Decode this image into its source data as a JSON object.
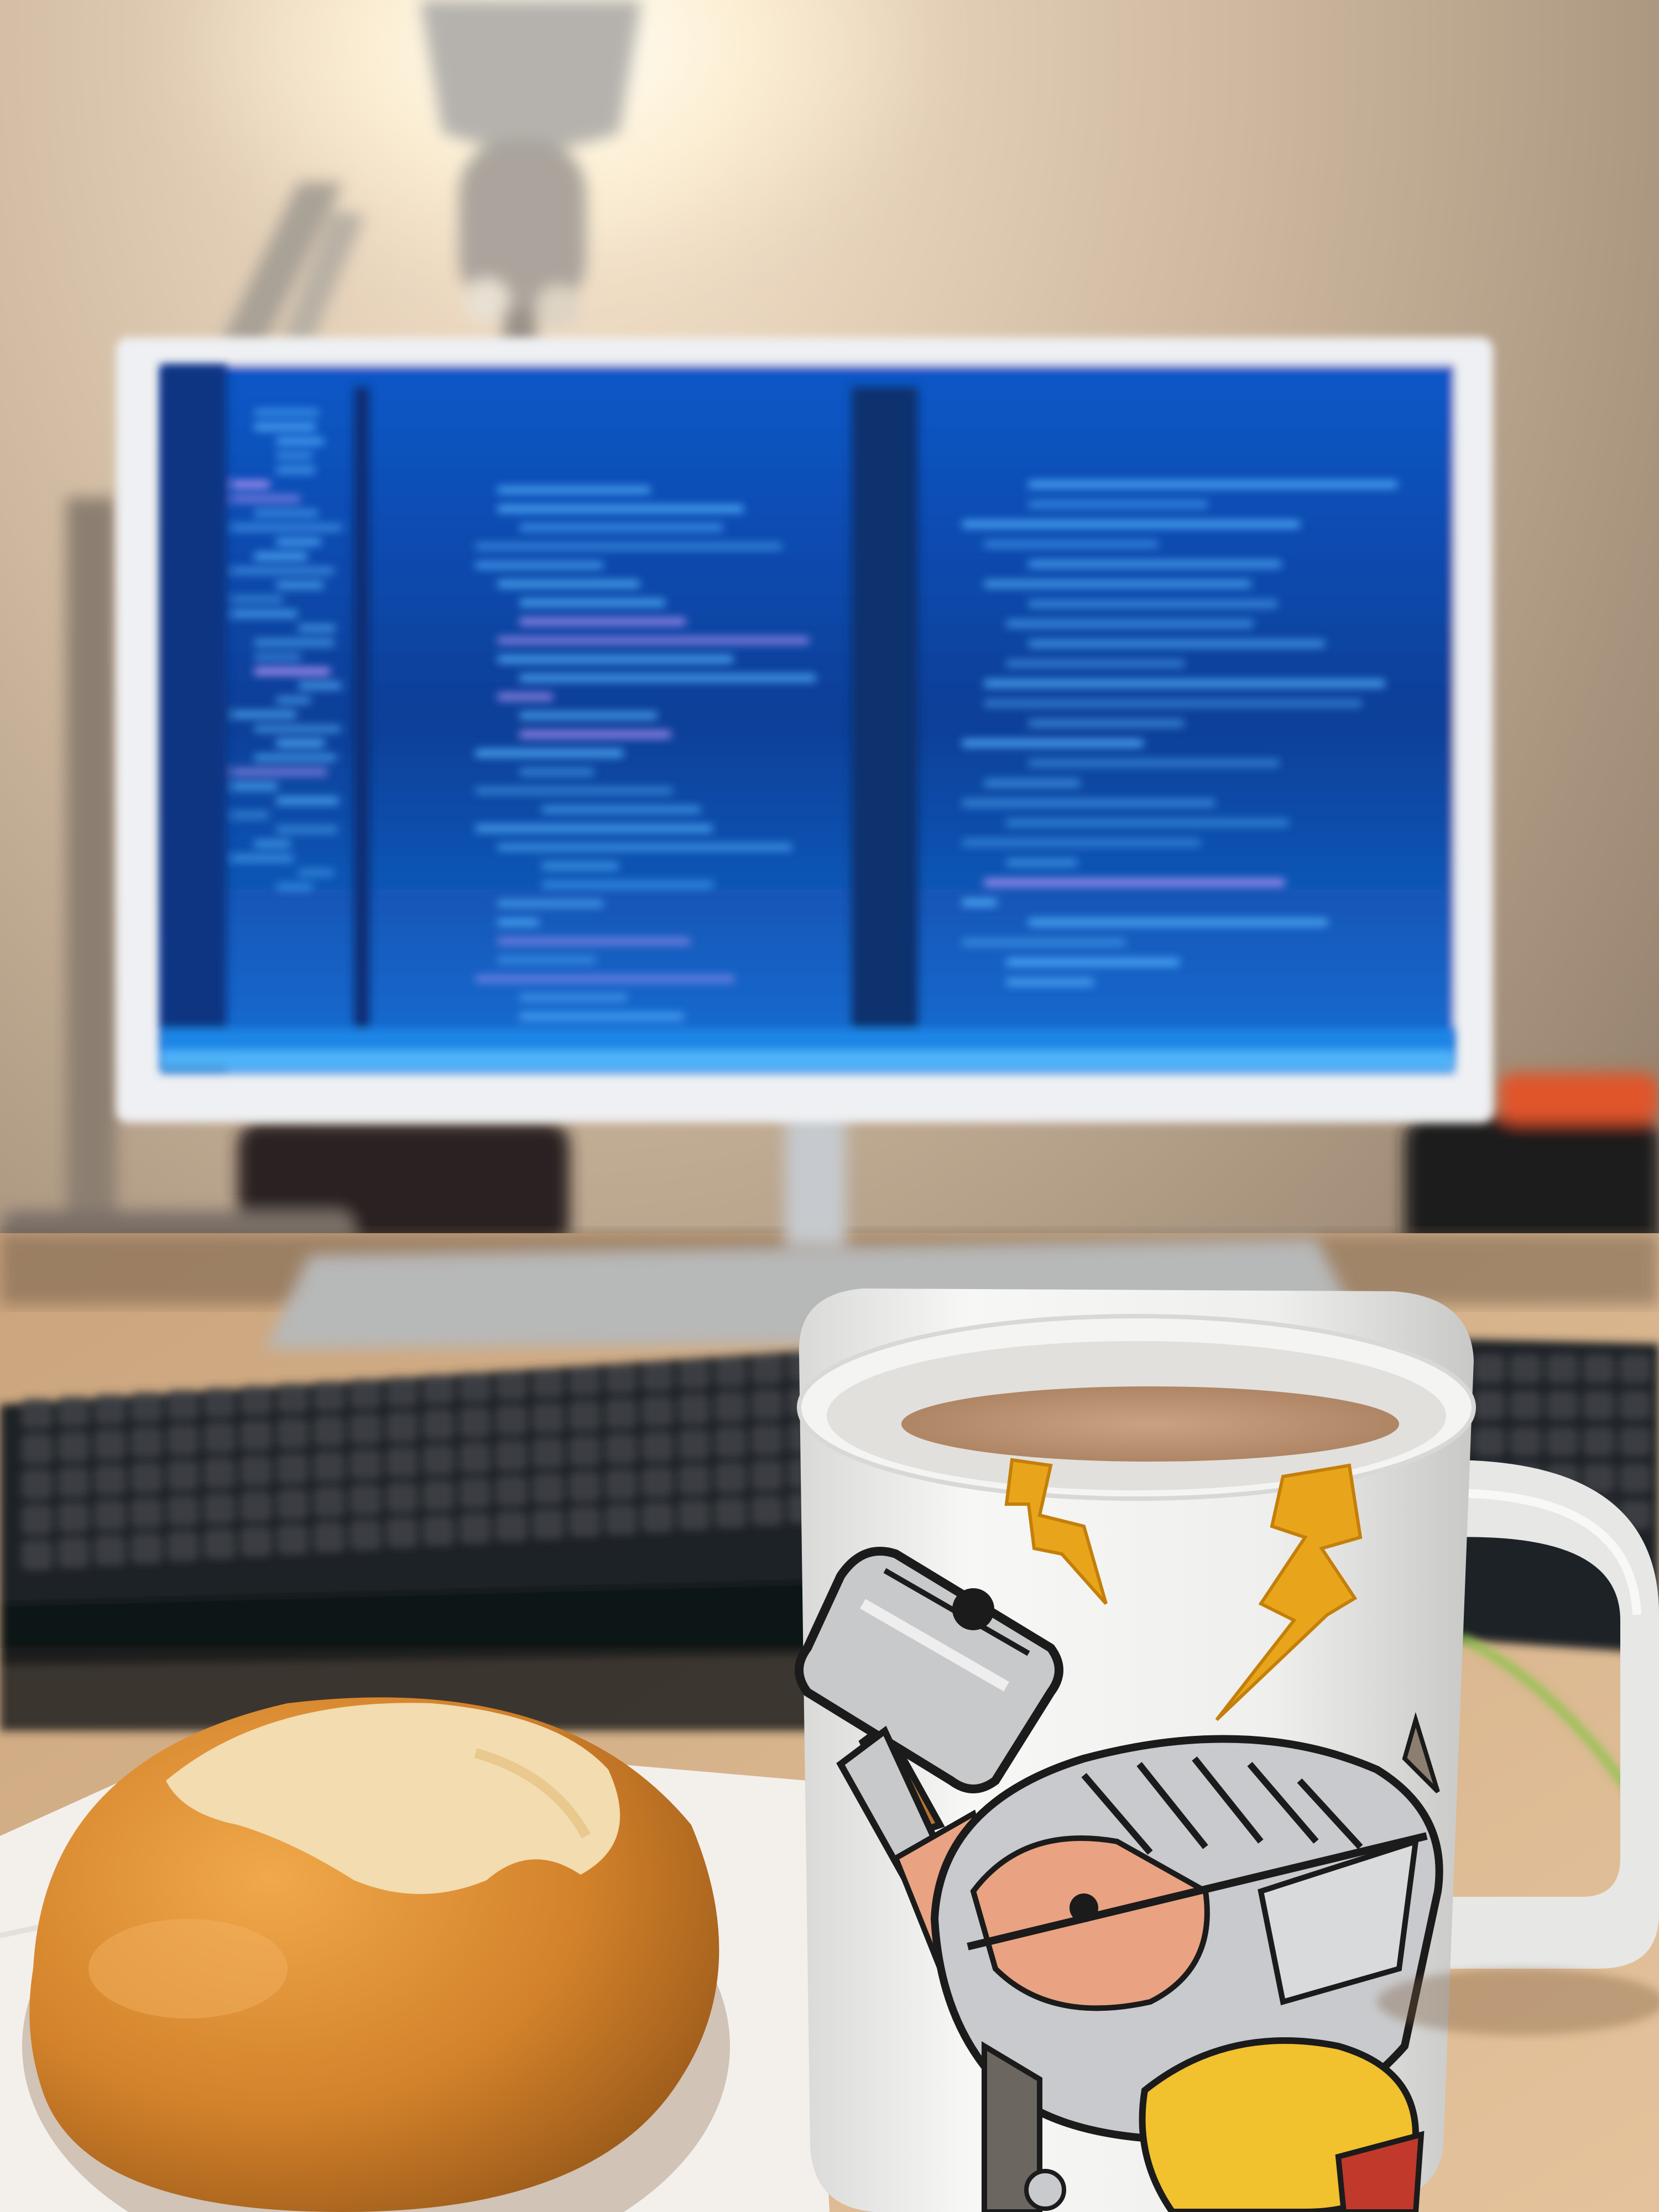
{
  "scene": {
    "subjects": [
      "desk-lamp",
      "computer-monitor",
      "keyboard",
      "coffee-mug",
      "bread-roll",
      "paper-napkin"
    ],
    "mug_print": "chibi-warrior-with-hammer-and-lightning-bolts"
  },
  "colors": {
    "wall": "#c9b29a",
    "lamp_glow": "#fff3d6",
    "monitor_frame": "#e8ebf0",
    "screen_bg": "#0c3d8f",
    "screen_text": "#57b6ff",
    "keyboard": "#1f2226",
    "desk": "#d9b48c",
    "mug": "#f2f2f0",
    "coffee": "#c39a77",
    "bolt": "#e8a51c",
    "bun": "#d98a2e",
    "napkin": "#f3f0ec",
    "cable": "#8bc34a"
  }
}
